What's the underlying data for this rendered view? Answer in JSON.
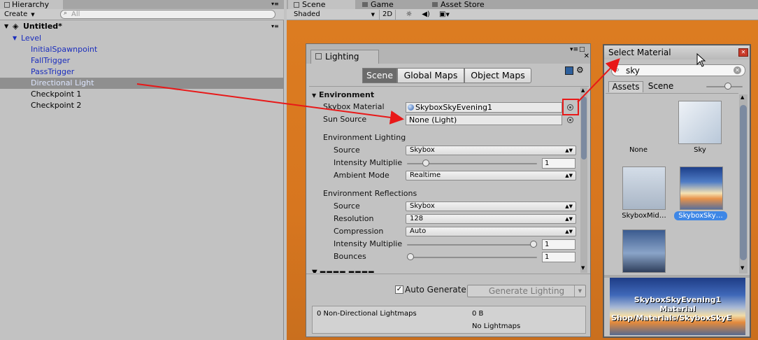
{
  "hierarchy": {
    "tab_label": "Hierarchy",
    "create_label": "Create",
    "search_placeholder": "All",
    "scene_name": "Untitled*",
    "items": [
      {
        "label": "Level"
      },
      {
        "label": "InitialSpawnpoint"
      },
      {
        "label": "FallTrigger"
      },
      {
        "label": "PassTrigger"
      },
      {
        "label": "Directional Light"
      },
      {
        "label": "Checkpoint 1"
      },
      {
        "label": "Checkpoint 2"
      }
    ]
  },
  "scene_view": {
    "tabs": [
      {
        "label": "Scene"
      },
      {
        "label": "Game"
      },
      {
        "label": "Asset Store"
      }
    ],
    "shading_mode": "Shaded",
    "mode_2d_label": "2D"
  },
  "lighting": {
    "window_title": "Lighting",
    "mode_tabs": [
      {
        "label": "Scene"
      },
      {
        "label": "Global Maps"
      },
      {
        "label": "Object Maps"
      }
    ],
    "environment_header": "Environment",
    "skybox_material_label": "Skybox Material",
    "skybox_material_value": "SkyboxSkyEvening1",
    "sun_source_label": "Sun Source",
    "sun_source_value": "None (Light)",
    "env_lighting_header": "Environment Lighting",
    "env_lighting": {
      "source_label": "Source",
      "source_value": "Skybox",
      "intensity_label": "Intensity Multiplie",
      "intensity_value": "1",
      "intensity_fraction": 0.125,
      "ambient_label": "Ambient Mode",
      "ambient_value": "Realtime"
    },
    "env_reflections_header": "Environment Reflections",
    "env_reflections": {
      "source_label": "Source",
      "source_value": "Skybox",
      "resolution_label": "Resolution",
      "resolution_value": "128",
      "compression_label": "Compression",
      "compression_value": "Auto",
      "intensity_label": "Intensity Multiplie",
      "intensity_value": "1",
      "intensity_fraction": 1.0,
      "bounces_label": "Bounces",
      "bounces_value": "1",
      "bounces_fraction": 0.0
    },
    "auto_generate_label": "Auto Generate",
    "auto_generate_checked": true,
    "generate_button_label": "Generate Lighting",
    "lightmaps_info_left": "0 Non-Directional Lightmaps",
    "lightmaps_info_size": "0 B",
    "lightmaps_info_status": "No Lightmaps"
  },
  "select_material": {
    "window_title": "Select Material",
    "search_value": "sky",
    "tabs": [
      {
        "label": "Assets"
      },
      {
        "label": "Scene"
      }
    ],
    "items": [
      {
        "label": "None"
      },
      {
        "label": "Sky"
      },
      {
        "label": "SkyboxMid…"
      },
      {
        "label": "SkyboxSky…"
      },
      {
        "label": ""
      }
    ],
    "preview_lines": [
      "SkyboxSkyEvening1",
      "Material",
      "Shop/Materials/SkyboxSkyE"
    ]
  },
  "colors": {
    "scene_background": "#d7761f",
    "annotation_red": "#e81818",
    "selected_row": "#8f8f8f",
    "selected_label": "#3e87e6"
  }
}
